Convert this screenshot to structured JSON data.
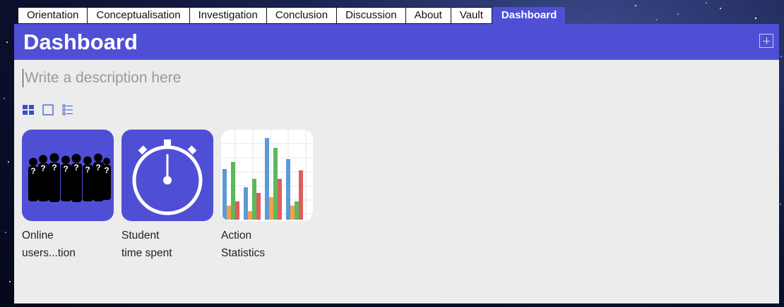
{
  "tabs": [
    "Orientation",
    "Conceptualisation",
    "Investigation",
    "Conclusion",
    "Discussion",
    "About",
    "Vault",
    "Dashboard"
  ],
  "active_tab": "Dashboard",
  "header": {
    "title": "Dashboard"
  },
  "description": {
    "placeholder": "Write a description here"
  },
  "tiles": [
    {
      "line1": "Online",
      "line2": "users...tion",
      "icon": "users-silhouette-icon"
    },
    {
      "line1": "Student",
      "line2": "time spent",
      "icon": "stopwatch-icon"
    },
    {
      "line1": "Action",
      "line2": "Statistics",
      "icon": "bar-chart-icon"
    }
  ],
  "colors": {
    "accent": "#4f4fd6",
    "panel": "#ececec"
  }
}
